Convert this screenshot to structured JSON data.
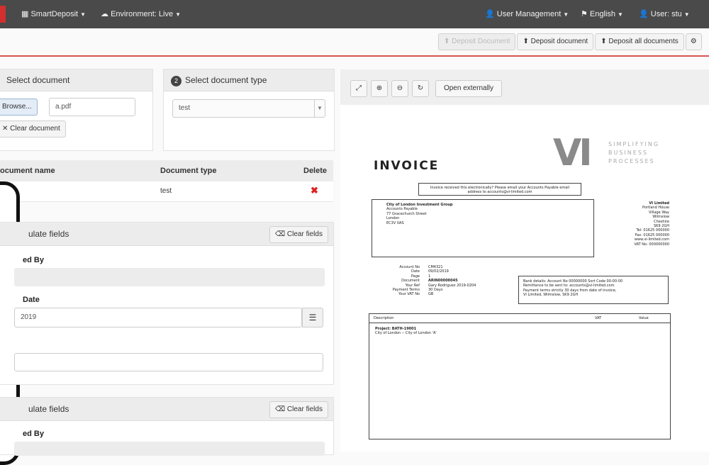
{
  "nav": {
    "product": "SmartDeposit",
    "environment": "Environment: Live",
    "user_management": "User Management",
    "language": "English",
    "user": "User: stu"
  },
  "toolbar": {
    "disabled_btn": "Deposit Document",
    "deposit": "Deposit document",
    "deposit_all": "Deposit all documents"
  },
  "select_doc": {
    "title": "Select document",
    "browse": "Browse...",
    "file": "a.pdf",
    "clear": "Clear document"
  },
  "select_type": {
    "number": "2",
    "title": "Select document type",
    "value": "test"
  },
  "table": {
    "headers": [
      "ocument name",
      "Document type",
      "Delete"
    ],
    "rows": [
      {
        "name": "",
        "type": "test"
      }
    ]
  },
  "populate1": {
    "title": "ulate fields",
    "clear": "Clear fields",
    "label1": "ed By",
    "label2": "Date",
    "date_value": "2019"
  },
  "populate2": {
    "title": "ulate fields",
    "clear": "Clear fields",
    "label1": "ed By"
  },
  "viewer": {
    "open_external": "Open externally"
  },
  "invoice": {
    "heading": "INVOICE",
    "logo_text": "VI",
    "tagline": [
      "SIMPLIFYING",
      "BUSINESS",
      "PROCESSES"
    ],
    "notice": [
      "Invoice received this electronically? Please email your Accounts Payable email",
      "address to accounts@vi-limited.com"
    ],
    "bill_to": [
      "City of London Investment Group",
      "Accounts Payable",
      "77 Gracechurch Street",
      "London",
      "EC3V 0AS"
    ],
    "company": [
      "VI Limited",
      "Portland House",
      "Village Way",
      "Wilmslow",
      "Cheshire",
      "SK9 2GH",
      "Tel: 01625 000000",
      "Fax: 01625 000000",
      "www.vi-limited.com",
      "VAT No: 000000000"
    ],
    "meta_labels": [
      "Account No",
      "Date",
      "Page",
      "Document",
      "Your Ref",
      "Payment Terms",
      "Your VAT No"
    ],
    "meta_values": [
      "CM4321",
      "09/02/2019",
      "1",
      "ARIN00000045",
      "Gary Rodriguez 2019-0204",
      "30 Days",
      "GB"
    ],
    "bank_note": [
      "Bank details: Account No 00000000 Sort Code 00-00-00",
      "Remittance to be sent to: accounts@vi-limited.com",
      "Payment terms strictly 30 days from date of invoice,",
      "VI Limited, Wilmslow, SK9 2GH"
    ],
    "line_headers": [
      "Description",
      "VAT",
      "Value"
    ],
    "lines": [
      "Project: BATH-19001",
      "City of London -- City of London 'A'"
    ]
  }
}
